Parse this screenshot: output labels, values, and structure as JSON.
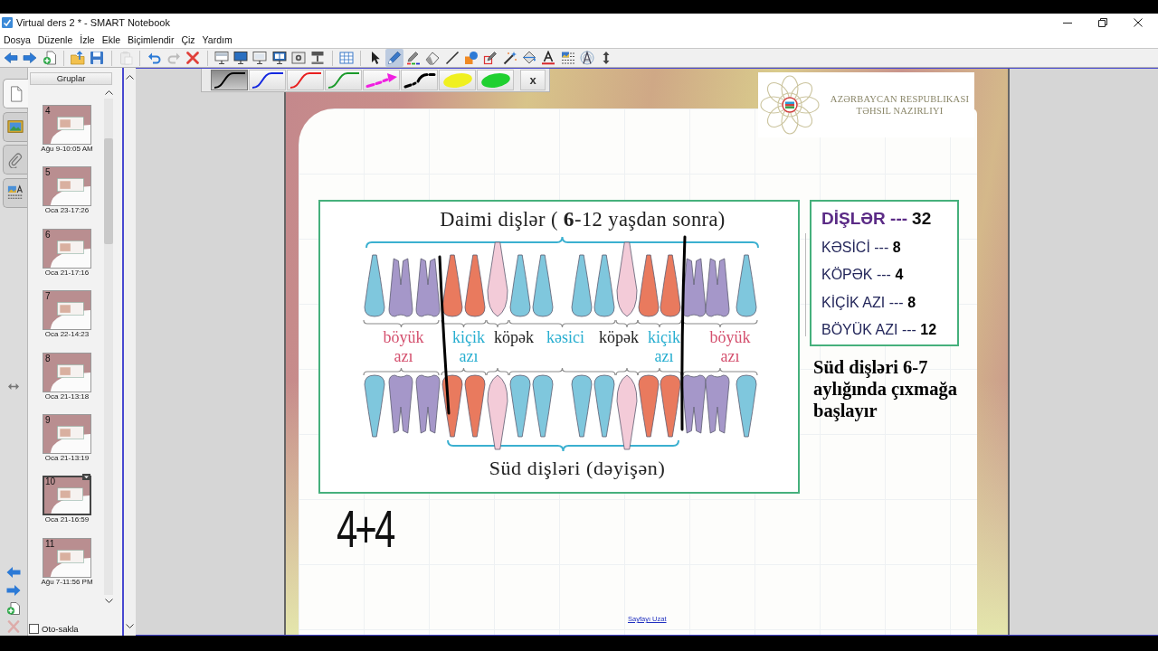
{
  "window": {
    "title": "Virtual ders 2 * - SMART Notebook"
  },
  "menu": [
    "Dosya",
    "Düzenle",
    "İzle",
    "Ekle",
    "Biçimlendir",
    "Çiz",
    "Yardım"
  ],
  "toolbar": [
    {
      "selected": false,
      "disabled": false
    },
    {
      "selected": false,
      "disabled": false
    },
    {
      "selected": false,
      "disabled": false
    },
    {
      "selected": false,
      "disabled": false
    },
    {
      "selected": false,
      "disabled": false
    },
    {
      "selected": false,
      "disabled": true
    },
    {
      "selected": false,
      "disabled": false
    },
    {
      "selected": false,
      "disabled": true
    },
    {
      "selected": false,
      "disabled": false
    },
    {
      "selected": false,
      "disabled": false
    },
    {
      "selected": false,
      "disabled": false
    },
    {
      "selected": false,
      "disabled": false
    },
    {
      "selected": false,
      "disabled": false
    },
    {
      "selected": false,
      "disabled": false
    },
    {
      "selected": false,
      "disabled": false
    },
    {
      "selected": false,
      "disabled": false
    },
    {
      "selected": false,
      "disabled": false
    },
    {
      "selected": true,
      "disabled": false
    },
    {
      "selected": false,
      "disabled": false
    },
    {
      "selected": false,
      "disabled": false
    },
    {
      "selected": false,
      "disabled": false
    },
    {
      "selected": false,
      "disabled": false
    },
    {
      "selected": false,
      "disabled": false
    },
    {
      "selected": false,
      "disabled": false
    },
    {
      "selected": false,
      "disabled": false
    },
    {
      "selected": false,
      "disabled": false
    },
    {
      "selected": false,
      "disabled": false
    },
    {
      "selected": false,
      "disabled": false
    },
    {
      "selected": false,
      "disabled": false
    }
  ],
  "sidebar": {
    "tabs": [
      {
        "selected": true
      },
      {
        "selected": false
      },
      {
        "selected": false
      },
      {
        "selected": false
      }
    ],
    "groups_button": "Gruplar",
    "pages": [
      {
        "number": "4",
        "date": "Ağu 9-10:05 AM",
        "selected": false
      },
      {
        "number": "5",
        "date": "Oca 23-17:26",
        "selected": false
      },
      {
        "number": "6",
        "date": "Oca 21-17:16",
        "selected": false
      },
      {
        "number": "7",
        "date": "Oca 22-14:23",
        "selected": false
      },
      {
        "number": "8",
        "date": "Oca 21-13:18",
        "selected": false
      },
      {
        "number": "9",
        "date": "Oca 21-13:19",
        "selected": false
      },
      {
        "number": "10",
        "date": "Oca 21-16:59",
        "selected": true
      },
      {
        "number": "11",
        "date": "Ağu 7-11:56 PM",
        "selected": false
      }
    ],
    "nav": [
      {
        "disabled": false
      },
      {
        "disabled": false
      },
      {
        "disabled": false
      },
      {
        "disabled": true
      }
    ],
    "auto_hide": {
      "label": "Oto-sakla",
      "checked": false
    }
  },
  "pen_toolbar": {
    "styles": [
      {
        "kind": "line",
        "color": "#000000",
        "selected": true
      },
      {
        "kind": "line",
        "color": "#1428e0",
        "selected": false
      },
      {
        "kind": "line",
        "color": "#e82020",
        "selected": false
      },
      {
        "kind": "line",
        "color": "#1a9a2a",
        "selected": false
      },
      {
        "kind": "arrow",
        "color": "#f020e0",
        "selected": false
      },
      {
        "kind": "dashdot",
        "color": "#000000",
        "selected": false
      },
      {
        "kind": "highlighter",
        "color": "#f0f020",
        "selected": false
      },
      {
        "kind": "highlighter",
        "color": "#20d030",
        "selected": false
      }
    ],
    "close": "x"
  },
  "slide": {
    "logo": {
      "lines": [
        "AZƏRBAYCAN RESPUBLIKASI",
        "TƏHSIL NAZIRLIYI"
      ]
    },
    "diagram": {
      "title": "Daimi dişlər ( **6**-12 yaşdan sonra)",
      "upper_teeth": [
        {
          "kind": "single",
          "color": "#7fc7dd"
        },
        {
          "kind": "molar",
          "color": "#a597c9"
        },
        {
          "kind": "molar",
          "color": "#a597c9"
        },
        {
          "kind": "single",
          "color": "#e97a5e"
        },
        {
          "kind": "single",
          "color": "#e97a5e"
        },
        {
          "kind": "canine",
          "color": "#f3cbd8"
        },
        {
          "kind": "single",
          "color": "#7fc7dd"
        },
        {
          "kind": "single",
          "color": "#7fc7dd"
        },
        {
          "kind": "single",
          "color": "#7fc7dd"
        },
        {
          "kind": "single",
          "color": "#7fc7dd"
        },
        {
          "kind": "canine",
          "color": "#f3cbd8"
        },
        {
          "kind": "single",
          "color": "#e97a5e"
        },
        {
          "kind": "single",
          "color": "#e97a5e"
        },
        {
          "kind": "molar",
          "color": "#a597c9"
        },
        {
          "kind": "molar",
          "color": "#a597c9"
        },
        {
          "kind": "single",
          "color": "#7fc7dd"
        }
      ],
      "labels": [
        {
          "text": "böyük azı",
          "color": "#d4506e"
        },
        {
          "text": "kiçik azı",
          "color": "#27aed0"
        },
        {
          "text": "köpək",
          "color": "#222222"
        },
        {
          "text": "kəsici",
          "color": "#27aed0"
        },
        {
          "text": "köpək",
          "color": "#222222"
        },
        {
          "text": "kiçik azı",
          "color": "#27aed0"
        },
        {
          "text": "böyük azı",
          "color": "#d4506e"
        }
      ],
      "lower_teeth": [
        {
          "kind": "single",
          "color": "#7fc7dd"
        },
        {
          "kind": "molar",
          "color": "#a597c9"
        },
        {
          "kind": "molar",
          "color": "#a597c9"
        },
        {
          "kind": "single",
          "color": "#e97a5e"
        },
        {
          "kind": "single",
          "color": "#e97a5e"
        },
        {
          "kind": "canine",
          "color": "#f3cbd8"
        },
        {
          "kind": "single",
          "color": "#7fc7dd"
        },
        {
          "kind": "single",
          "color": "#7fc7dd"
        },
        {
          "kind": "single",
          "color": "#7fc7dd"
        },
        {
          "kind": "single",
          "color": "#7fc7dd"
        },
        {
          "kind": "canine",
          "color": "#f3cbd8"
        },
        {
          "kind": "single",
          "color": "#e97a5e"
        },
        {
          "kind": "single",
          "color": "#e97a5e"
        },
        {
          "kind": "molar",
          "color": "#a597c9"
        },
        {
          "kind": "molar",
          "color": "#a597c9"
        },
        {
          "kind": "single",
          "color": "#7fc7dd"
        }
      ],
      "caption": "Süd dişləri (dəyişən)"
    },
    "summary": {
      "title": {
        "label": "DİŞLƏR ---",
        "value": "32"
      },
      "rows": [
        "KƏSİCİ --- **8**",
        "KÖPƏK --- **4**",
        "KİÇİK AZI --- **8**",
        "BÖYÜK AZI --- **12**"
      ]
    },
    "note": "Süd dişləri 6-7 aylığında çıxmağa başlayır",
    "handwriting": "4+4",
    "extend_link": "Sayfayı Uzat"
  }
}
